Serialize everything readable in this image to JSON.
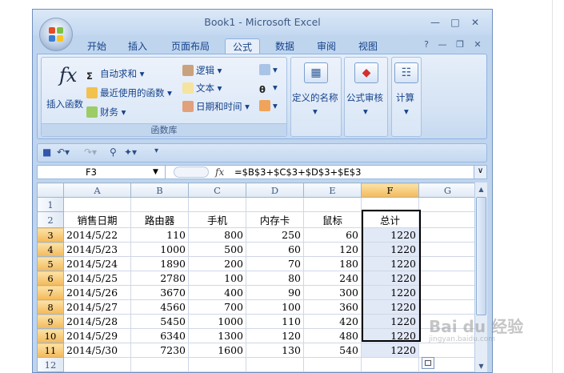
{
  "window": {
    "title": "Book1 - Microsoft Excel"
  },
  "tabs": [
    "开始",
    "插入",
    "页面布局",
    "公式",
    "数据",
    "审阅",
    "视图"
  ],
  "ribbon": {
    "insert_function": "插入函数",
    "autosum": "自动求和",
    "recent": "最近使用的函数",
    "financial": "财务",
    "logical": "逻辑",
    "text": "文本",
    "datetime": "日期和时间",
    "group_label": "函数库",
    "define_name": "定义的名称",
    "audit": "公式审核",
    "calc": "计算"
  },
  "formula_bar": {
    "name_box": "F3",
    "fx": "fx",
    "formula": "=$B$3+$C$3+$D$3+$E$3"
  },
  "sheet": {
    "columns": [
      "A",
      "B",
      "C",
      "D",
      "E",
      "F",
      "G"
    ],
    "row_numbers": [
      "1",
      "2",
      "3",
      "4",
      "5",
      "6",
      "7",
      "8",
      "9",
      "10",
      "11",
      "12"
    ],
    "headers": [
      "销售日期",
      "路由器",
      "手机",
      "内存卡",
      "鼠标",
      "总计"
    ],
    "rows": [
      [
        "2014/5/22",
        "110",
        "800",
        "250",
        "60",
        "1220"
      ],
      [
        "2014/5/23",
        "1000",
        "500",
        "60",
        "120",
        "1220"
      ],
      [
        "2014/5/24",
        "1890",
        "200",
        "70",
        "180",
        "1220"
      ],
      [
        "2014/5/25",
        "2780",
        "100",
        "80",
        "240",
        "1220"
      ],
      [
        "2014/5/26",
        "3670",
        "400",
        "90",
        "300",
        "1220"
      ],
      [
        "2014/5/27",
        "4560",
        "700",
        "100",
        "360",
        "1220"
      ],
      [
        "2014/5/28",
        "5450",
        "1000",
        "110",
        "420",
        "1220"
      ],
      [
        "2014/5/29",
        "6340",
        "1300",
        "120",
        "480",
        "1220"
      ],
      [
        "2014/5/30",
        "7230",
        "1600",
        "130",
        "540",
        "1220"
      ]
    ]
  },
  "watermark": {
    "text": "Bai du 经验",
    "sub": "jingyan.baidu.com"
  }
}
